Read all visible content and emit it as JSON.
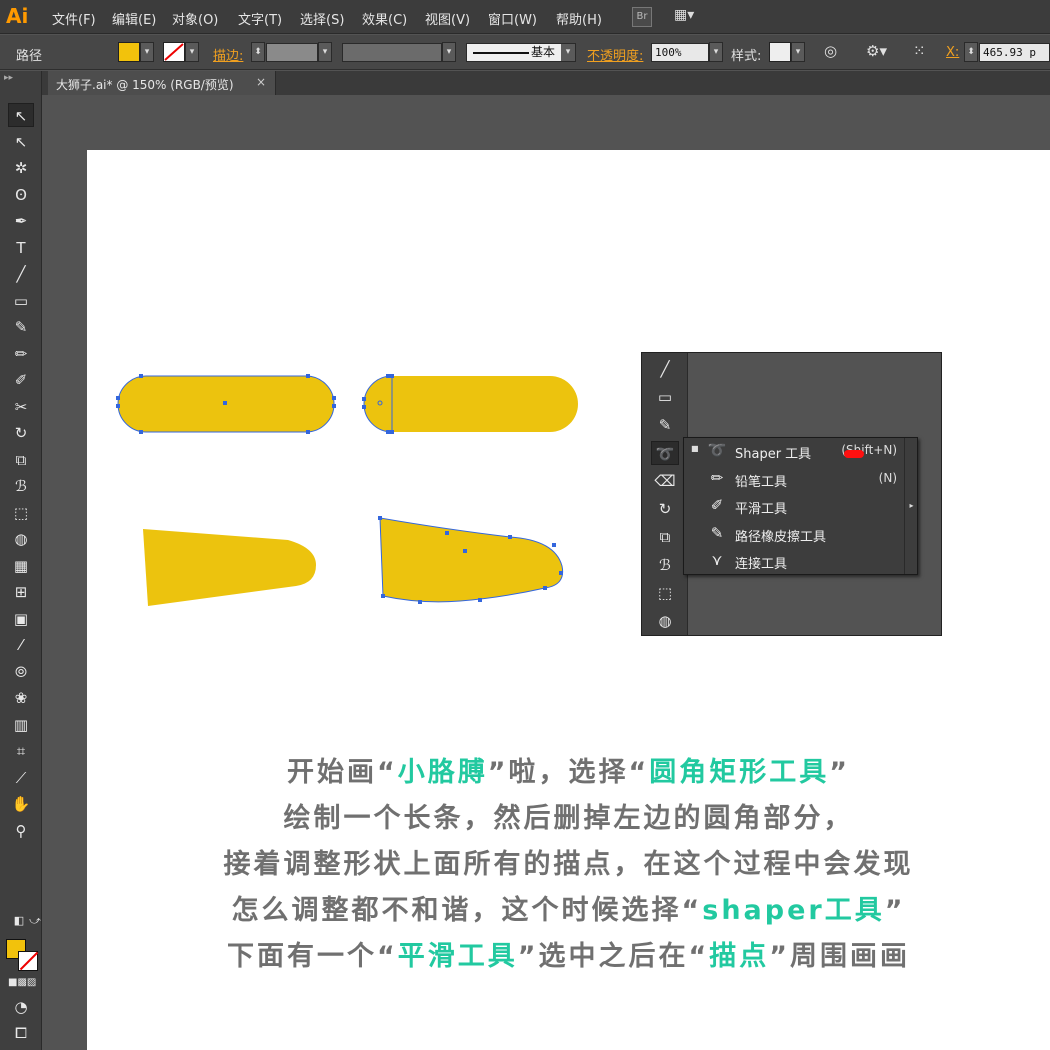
{
  "app": {
    "logo": "Ai",
    "menus": [
      "文件(F)",
      "编辑(E)",
      "对象(O)",
      "文字(T)",
      "选择(S)",
      "效果(C)",
      "视图(V)",
      "窗口(W)",
      "帮助(H)"
    ],
    "bridge_label": "Br",
    "arrange_icon": "grid-layout-icon"
  },
  "control_bar": {
    "selection_label": "路径",
    "fill_color": "#f2c20c",
    "stroke_label": "描边:",
    "stroke_profile_label": "基本",
    "opacity_label": "不透明度:",
    "opacity_value": "100%",
    "style_label": "样式:",
    "x_label": "X:",
    "x_value": "465.93 p"
  },
  "document_tab": {
    "title": "大狮子.ai* @ 150% (RGB/预览)",
    "close": "×"
  },
  "tools": [
    {
      "name": "selection-tool-icon",
      "glyph": "↖"
    },
    {
      "name": "direct-selection-tool-icon",
      "glyph": "↖"
    },
    {
      "name": "magic-wand-tool-icon",
      "glyph": "✲"
    },
    {
      "name": "lasso-tool-icon",
      "glyph": "ʘ"
    },
    {
      "name": "pen-tool-icon",
      "glyph": "✒"
    },
    {
      "name": "type-tool-icon",
      "glyph": "T"
    },
    {
      "name": "line-tool-icon",
      "glyph": "╱"
    },
    {
      "name": "rectangle-tool-icon",
      "glyph": "▭"
    },
    {
      "name": "paintbrush-tool-icon",
      "glyph": "✎"
    },
    {
      "name": "pencil-tool-icon",
      "glyph": "✏"
    },
    {
      "name": "blob-brush-tool-icon",
      "glyph": "✐"
    },
    {
      "name": "scissors-tool-icon",
      "glyph": "✂"
    },
    {
      "name": "rotate-tool-icon",
      "glyph": "↻"
    },
    {
      "name": "scale-tool-icon",
      "glyph": "⧉"
    },
    {
      "name": "warp-tool-icon",
      "glyph": "ℬ"
    },
    {
      "name": "free-transform-tool-icon",
      "glyph": "⬚"
    },
    {
      "name": "shape-builder-tool-icon",
      "glyph": "◍"
    },
    {
      "name": "perspective-grid-tool-icon",
      "glyph": "▦"
    },
    {
      "name": "mesh-tool-icon",
      "glyph": "⊞"
    },
    {
      "name": "gradient-tool-icon",
      "glyph": "▣"
    },
    {
      "name": "eyedropper-tool-icon",
      "glyph": "⁄"
    },
    {
      "name": "blend-tool-icon",
      "glyph": "⦾"
    },
    {
      "name": "symbol-sprayer-tool-icon",
      "glyph": "❀"
    },
    {
      "name": "column-graph-tool-icon",
      "glyph": "▥"
    },
    {
      "name": "artboard-tool-icon",
      "glyph": "⌗"
    },
    {
      "name": "slice-tool-icon",
      "glyph": "⟋"
    },
    {
      "name": "hand-tool-icon",
      "glyph": "✋"
    },
    {
      "name": "zoom-tool-icon",
      "glyph": "⚲"
    }
  ],
  "flyout": {
    "tools": [
      {
        "name": "line-tool-icon",
        "glyph": "╱"
      },
      {
        "name": "rectangle-tool-icon",
        "glyph": "▭"
      },
      {
        "name": "paintbrush-tool-icon",
        "glyph": "✎"
      },
      {
        "name": "shaper-tool-icon",
        "glyph": "➰"
      },
      {
        "name": "eraser-tool-icon",
        "glyph": "⌫"
      },
      {
        "name": "rotate-tool-icon",
        "glyph": "↻"
      },
      {
        "name": "scale-tool-icon",
        "glyph": "⧉"
      },
      {
        "name": "warp-tool-icon",
        "glyph": "ℬ"
      },
      {
        "name": "free-transform-tool-icon",
        "glyph": "⬚"
      },
      {
        "name": "shape-builder-tool-icon",
        "glyph": "◍"
      }
    ],
    "menu": [
      {
        "bullet": "■",
        "icon": "shaper-tool-icon",
        "glyph": "➰",
        "label": "Shaper 工具",
        "shortcut": "(Shift+N)"
      },
      {
        "bullet": "",
        "icon": "pencil-tool-icon",
        "glyph": "✏",
        "label": "铅笔工具",
        "shortcut": "(N)"
      },
      {
        "bullet": "",
        "icon": "smooth-tool-icon",
        "glyph": "✐",
        "label": "平滑工具",
        "shortcut": ""
      },
      {
        "bullet": "",
        "icon": "path-eraser-tool-icon",
        "glyph": "✎",
        "label": "路径橡皮擦工具",
        "shortcut": ""
      },
      {
        "bullet": "",
        "icon": "join-tool-icon",
        "glyph": "⋎",
        "label": "连接工具",
        "shortcut": ""
      }
    ],
    "scroll_arrow": "▸"
  },
  "caption": {
    "line1_a": "开始画“",
    "line1_b": "小胳膊",
    "line1_c": "”啦，选择“",
    "line1_d": "圆角矩形工具",
    "line1_e": "”",
    "line2": "绘制一个长条，然后删掉左边的圆角部分，",
    "line3": "接着调整形状上面所有的描点，在这个过程中会发现",
    "line4_a": "怎么调整都不和谐，这个时候选择“",
    "line4_b": "shaper工具",
    "line4_c": "”",
    "line5_a": "下面有一个“",
    "line5_b": "平滑工具",
    "line5_c": "”选中之后在“",
    "line5_d": "描点",
    "line5_e": "”周围画画"
  },
  "colors": {
    "shape_fill": "#ecc30e",
    "anchor": "#3366dd",
    "highlight": "#22c9a0",
    "caption_text": "#707070"
  }
}
